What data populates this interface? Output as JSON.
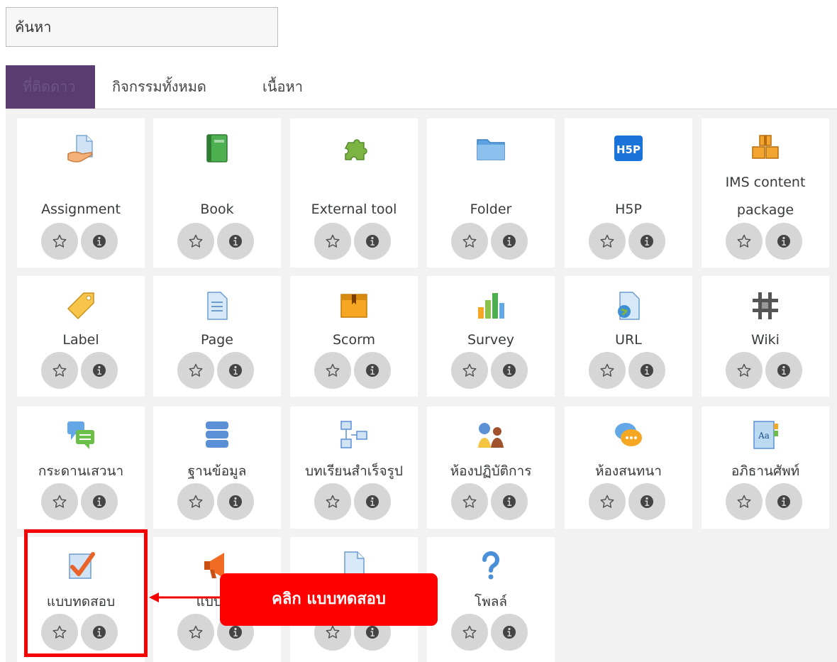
{
  "search": {
    "placeholder": "ค้นหา",
    "value": ""
  },
  "tabs": [
    {
      "label": "ที่ติดดาว",
      "active": true
    },
    {
      "label": "กิจกรรมทั้งหมด",
      "active": false
    },
    {
      "label": "เนื้อหา",
      "active": false
    }
  ],
  "rows": [
    [
      {
        "label_lines": [
          "Assignment"
        ],
        "icon": "assignment-icon"
      },
      {
        "label_lines": [
          "Book"
        ],
        "icon": "book-icon"
      },
      {
        "label_lines": [
          "External tool"
        ],
        "icon": "external-tool-icon"
      },
      {
        "label_lines": [
          "Folder"
        ],
        "icon": "folder-icon"
      },
      {
        "label_lines": [
          "H5P"
        ],
        "icon": "h5p-icon"
      },
      {
        "label_lines": [
          "IMS content",
          "package"
        ],
        "icon": "ims-package-icon"
      }
    ],
    [
      {
        "label_lines": [
          "Label"
        ],
        "icon": "label-icon"
      },
      {
        "label_lines": [
          "Page"
        ],
        "icon": "page-icon"
      },
      {
        "label_lines": [
          "Scorm"
        ],
        "icon": "scorm-icon"
      },
      {
        "label_lines": [
          "Survey"
        ],
        "icon": "survey-icon"
      },
      {
        "label_lines": [
          "URL"
        ],
        "icon": "url-icon"
      },
      {
        "label_lines": [
          "Wiki"
        ],
        "icon": "wiki-icon"
      }
    ],
    [
      {
        "label_lines": [
          "กระดานเสวนา"
        ],
        "icon": "forum-icon"
      },
      {
        "label_lines": [
          "ฐานข้อมูล"
        ],
        "icon": "database-icon"
      },
      {
        "label_lines": [
          "บทเรียนสำเร็จรูป"
        ],
        "icon": "lesson-icon"
      },
      {
        "label_lines": [
          "ห้องปฏิบัติการ"
        ],
        "icon": "workshop-icon"
      },
      {
        "label_lines": [
          "ห้องสนทนา"
        ],
        "icon": "chat-icon"
      },
      {
        "label_lines": [
          "อภิธานศัพท์"
        ],
        "icon": "glossary-icon"
      }
    ],
    [
      {
        "label_lines": [
          "แบบทดสอบ"
        ],
        "icon": "quiz-icon"
      },
      {
        "label_lines": [
          "แบบสำ"
        ],
        "icon": "feedback-icon"
      },
      {
        "label_lines": [
          ""
        ],
        "icon": "resource-icon"
      },
      {
        "label_lines": [
          "โพลล์"
        ],
        "icon": "choice-icon"
      }
    ]
  ],
  "buttons": {
    "star_icon": "star-outline-icon",
    "info_icon": "info-icon"
  },
  "callout": {
    "text": "คลิก แบบทดสอบ"
  },
  "colors": {
    "active_tab": "#5b3c71",
    "highlight": "#f50000",
    "callout_bg": "#ff0000",
    "tile_bg": "#ffffff",
    "grid_bg": "#f2f2f2",
    "button_bg": "#d6d6d6"
  }
}
